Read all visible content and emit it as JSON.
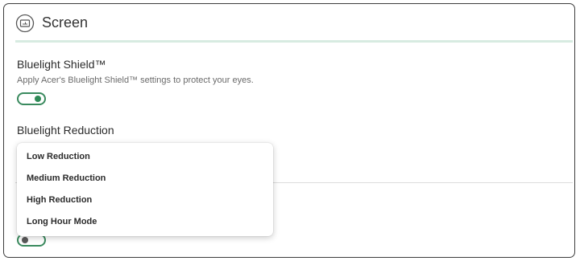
{
  "header": {
    "title": "Screen",
    "icon": "screen-icon"
  },
  "bluelight_shield": {
    "title": "Bluelight Shield™",
    "description": "Apply Acer's Bluelight Shield™ settings to protect your eyes.",
    "enabled": true
  },
  "bluelight_reduction": {
    "title": "Bluelight Reduction",
    "options": [
      "Low Reduction",
      "Medium Reduction",
      "High Reduction",
      "Long Hour Mode"
    ]
  },
  "second_toggle": {
    "enabled": false
  },
  "colors": {
    "accent": "#2f8a57",
    "header_line": "#d7ebe1"
  }
}
